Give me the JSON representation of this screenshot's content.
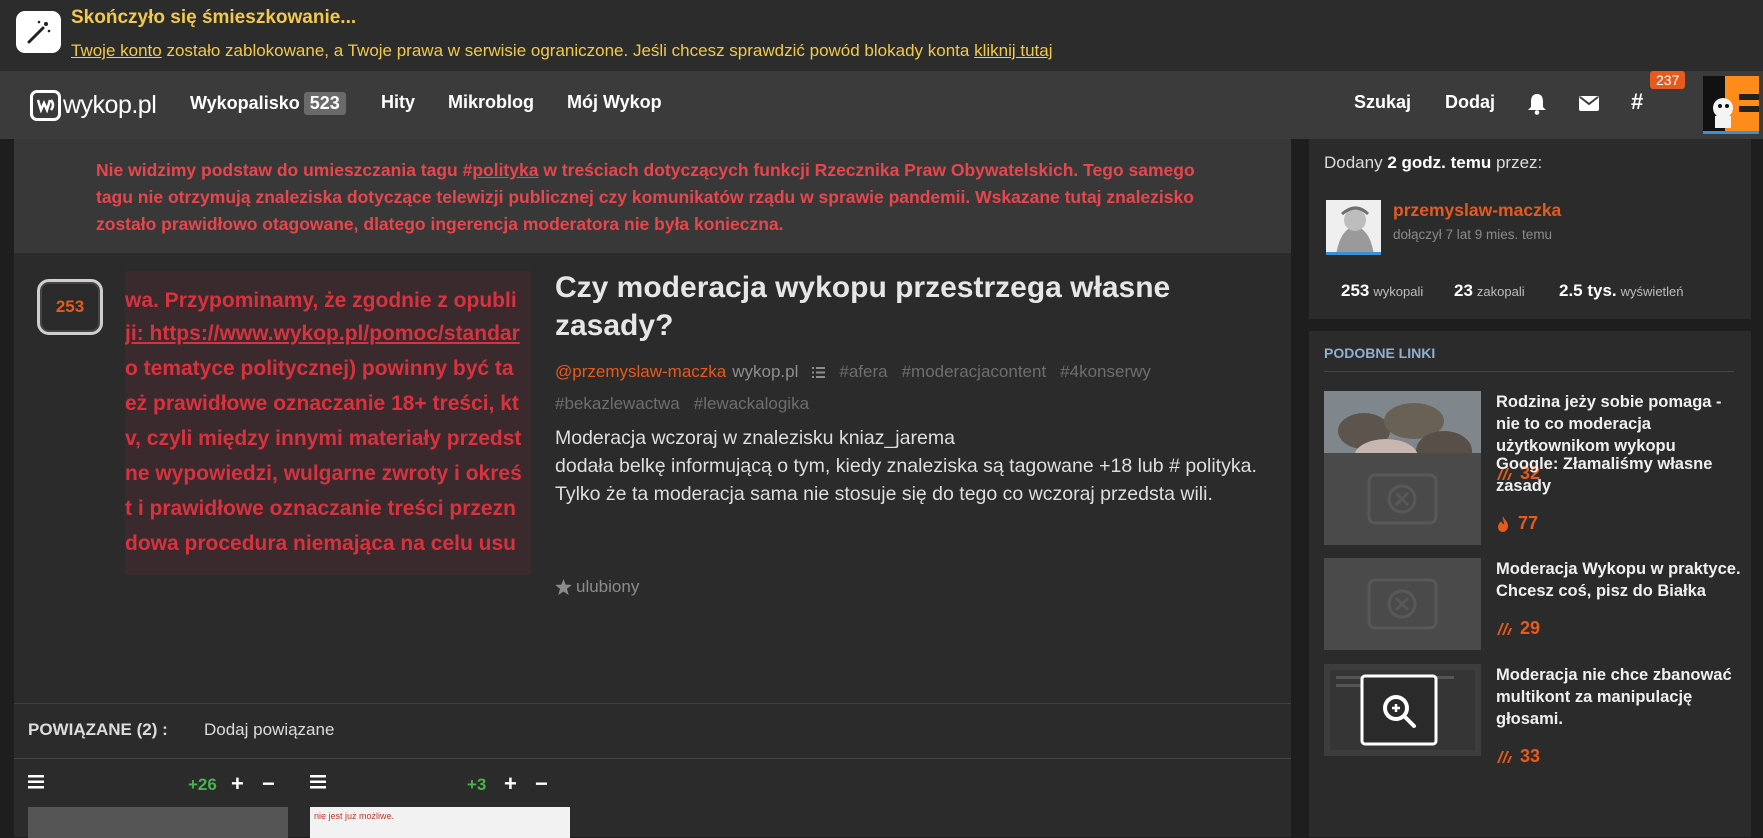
{
  "banner": {
    "title": "Skończyło się śmieszkowanie...",
    "link_account": "Twoje konto",
    "text_middle": " zostało zablokowane, a Twoje prawa w serwisie ograniczone. Jeśli chcesz sprawdzić powód blokady konta ",
    "link_click": "kliknij tutaj"
  },
  "nav": {
    "logo": "wykop.pl",
    "items": [
      {
        "label": "Wykopalisko",
        "count": "523"
      },
      {
        "label": "Hity"
      },
      {
        "label": "Mikroblog"
      },
      {
        "label": "Mój Wykop"
      }
    ],
    "search": "Szukaj",
    "add": "Dodaj",
    "hashtag": "#",
    "hashtag_badge": "237"
  },
  "moderation_note": {
    "part1": "Nie widzimy podstaw do umieszczania tagu #",
    "tag": "polityka",
    "part2": " w treściach dotyczących funkcji Rzecznika Praw Obywatelskich. Tego samego tagu nie otrzymują znaleziska dotyczące telewizji publicznej czy komunikatów rządu w sprawie pandemii. Wskazane tutaj znalezisko zostało prawidłowo otagowane, dlatego ingerencja moderatora nie była konieczna."
  },
  "article": {
    "votes": "253",
    "thumbnail_lines": [
      "wa. Przypominamy, że zgodnie z opubli",
      "ji: https://www.wykop.pl/pomoc/standar",
      " o tematyce politycznej) powinny być ta",
      "eż prawidłowe oznaczanie 18+ treści, kt",
      "v, czyli między innymi materiały przedst",
      "ne wypowiedzi, wulgarne zwroty i okreś",
      "t i prawidłowe oznaczanie treści przezn",
      "dowa procedura niemająca na celu usu"
    ],
    "title": "Czy moderacja wykopu przestrzega własne zasady?",
    "author": "@przemyslaw-maczka",
    "domain": "wykop.pl",
    "tags": [
      "#afera",
      "#moderacjacontent",
      "#4konserwy",
      "#bekazlewactwa",
      "#lewackalogika"
    ],
    "description": [
      "Moderacja wczoraj w znalezisku kniaz_jarema",
      "dodała belkę informującą o tym, kiedy znaleziska są tagowane +18 lub # polityka.",
      "Tylko że ta moderacja sama nie stosuje się do tego co wczoraj przedsta wili."
    ],
    "favorite": "ulubiony"
  },
  "related": {
    "title": "POWIĄZANE (2) :",
    "add": "Dodaj powiązane",
    "cards": [
      {
        "score": "+26",
        "plus": "+",
        "minus": "−"
      },
      {
        "score": "+3",
        "plus": "+",
        "minus": "−",
        "snippet": "nie jest już możliwe."
      }
    ]
  },
  "sidebar": {
    "added_prefix": "Dodany ",
    "added_time": "2 godz. temu",
    "added_suffix": " przez:",
    "username": "przemyslaw-maczka",
    "joined": "dołączył 7 lat 9 mies. temu",
    "stats": [
      {
        "value": "253",
        "label": "wykopali"
      },
      {
        "value": "23",
        "label": "zakopali"
      },
      {
        "value": "2.5 tys.",
        "label": "wyświetleń"
      }
    ],
    "similar_heading": "PODOBNE LINKI",
    "similar": [
      {
        "title": "Rodzina jeży sobie pomaga - nie to co moderacja użytkownikom wykopu",
        "score": "32",
        "icon": "wykop-icon"
      },
      {
        "title": "Google: Złamaliśmy własne zasady",
        "score": "77",
        "icon": "hot-icon"
      },
      {
        "title": "Moderacja Wykopu w praktyce. Chcesz coś, pisz do Białka",
        "score": "29",
        "icon": "wykop-icon"
      },
      {
        "title": "Moderacja nie chce zbanować multikont za manipulację głosami.",
        "score": "33",
        "icon": "wykop-icon"
      }
    ]
  },
  "colors": {
    "accent": "#e65a1e",
    "banner_text": "#f2c94c",
    "moderation_text": "#e8454c",
    "positive": "#4caf50"
  }
}
